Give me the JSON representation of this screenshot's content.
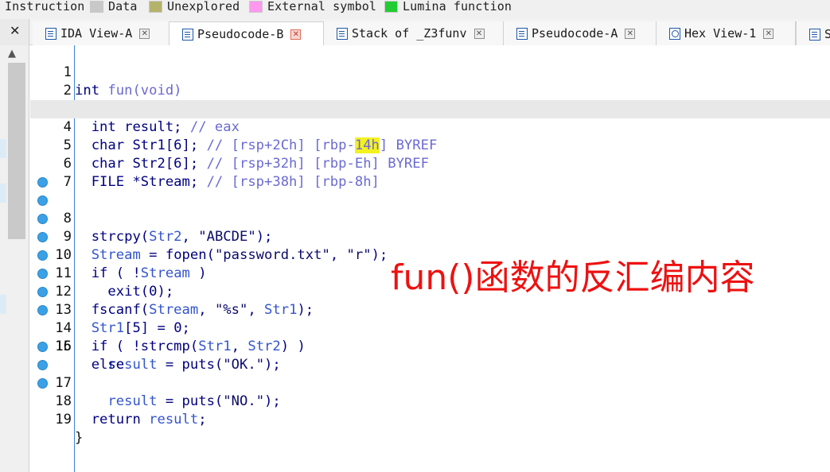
{
  "legend": [
    {
      "label": "Instruction",
      "color": "#f0f0f0"
    },
    {
      "label": "Data",
      "color": "#c8c8c8"
    },
    {
      "label": "Unexplored",
      "color": "#b5b36a"
    },
    {
      "label": "External symbol",
      "color": "#ff99ee"
    },
    {
      "label": "Lumina function",
      "color": "#22cc33"
    }
  ],
  "side_close": "✕",
  "tabs": [
    {
      "label": "IDA View-A",
      "icon": "listing-icon",
      "active": false
    },
    {
      "label": "Pseudocode-B",
      "icon": "listing-icon",
      "active": true
    },
    {
      "label": "Stack of _Z3funv",
      "icon": "listing-icon",
      "active": false
    },
    {
      "label": "Pseudocode-A",
      "icon": "listing-icon",
      "active": false
    },
    {
      "label": "Hex View-1",
      "icon": "hex-icon",
      "active": false
    },
    {
      "label": "S",
      "icon": "struct-icon",
      "active": false
    }
  ],
  "tab_close": "✕",
  "scroll_up_arrow": "▲",
  "code": {
    "current_line": 4,
    "lines": [
      {
        "n": "1",
        "bp": false,
        "text": "int fun(void)"
      },
      {
        "n": "2",
        "bp": false,
        "text": "{"
      },
      {
        "n": "3",
        "bp": false,
        "text": "  int result; // eax"
      },
      {
        "n": "4",
        "bp": false,
        "text": "  char Str1[6]; // [rsp+2Ch] [rbp-14h] BYREF"
      },
      {
        "n": "5",
        "bp": false,
        "text": "  char Str2[6]; // [rsp+32h] [rbp-Eh] BYREF"
      },
      {
        "n": "6",
        "bp": false,
        "text": "  FILE *Stream; // [rsp+38h] [rbp-8h]"
      },
      {
        "n": "7",
        "bp": false,
        "text": ""
      },
      {
        "n": "8",
        "bp": true,
        "text": "  strcpy(Str2, \"ABCDE\");"
      },
      {
        "n": "9",
        "bp": true,
        "text": "  Stream = fopen(\"password.txt\", \"r\");"
      },
      {
        "n": "10",
        "bp": true,
        "text": "  if ( !Stream )"
      },
      {
        "n": "11",
        "bp": true,
        "text": "    exit(0);"
      },
      {
        "n": "12",
        "bp": true,
        "text": "  fscanf(Stream, \"%s\", Str1);"
      },
      {
        "n": "13",
        "bp": true,
        "text": "  Str1[5] = 0;"
      },
      {
        "n": "14",
        "bp": true,
        "text": "  if ( !strcmp(Str1, Str2) )"
      },
      {
        "n": "15",
        "bp": true,
        "text": "    result = puts(\"OK.\");"
      },
      {
        "n": "16",
        "bp": false,
        "text": "  else"
      },
      {
        "n": "17",
        "bp": true,
        "text": "    result = puts(\"NO.\");"
      },
      {
        "n": "18",
        "bp": true,
        "text": "  return result;"
      },
      {
        "n": "19",
        "bp": true,
        "text": "}"
      }
    ]
  },
  "annotation": "fun()函数的反汇编内容"
}
